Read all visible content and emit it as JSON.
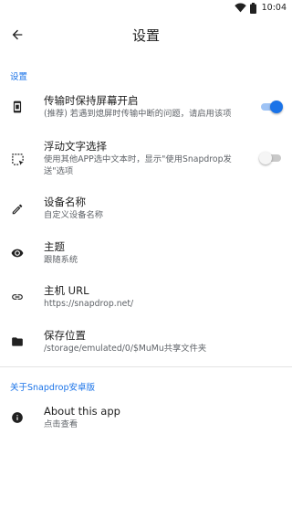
{
  "status_bar": {
    "time": "10:04",
    "icons": [
      "wifi-icon",
      "battery-icon"
    ]
  },
  "app_bar": {
    "title": "设置",
    "back_icon": "arrow-back-icon"
  },
  "colors": {
    "accent": "#1a73e8",
    "switch_track_on": "#9ec3f5",
    "switch_off": "#c9c9c9",
    "text_primary": "#212121",
    "text_secondary": "#5f6368"
  },
  "sections": [
    {
      "header": "设置",
      "items": [
        {
          "icon": "phone-screen-icon",
          "title": "传输时保持屏幕开启",
          "summary": "(推荐) 若遇到熄屏时传输中断的问题，请启用该项",
          "switch": true,
          "switch_on": true
        },
        {
          "icon": "text-select-icon",
          "title": "浮动文字选择",
          "summary": "使用其他APP选中文本时，显示\"使用Snapdrop发送\"选项",
          "switch": true,
          "switch_on": false
        },
        {
          "icon": "edit-icon",
          "title": "设备名称",
          "summary": "自定义设备名称",
          "switch": false
        },
        {
          "icon": "eye-icon",
          "title": "主题",
          "summary": "跟随系统",
          "switch": false
        },
        {
          "icon": "link-icon",
          "title": "主机 URL",
          "summary": "https://snapdrop.net/",
          "switch": false
        },
        {
          "icon": "folder-icon",
          "title": "保存位置",
          "summary": "/storage/emulated/0/$MuMu共享文件夹",
          "switch": false
        }
      ]
    },
    {
      "header": "关于Snapdrop安卓版",
      "items": [
        {
          "icon": "info-icon",
          "title": "About this app",
          "summary": "点击查看",
          "switch": false
        }
      ]
    }
  ]
}
